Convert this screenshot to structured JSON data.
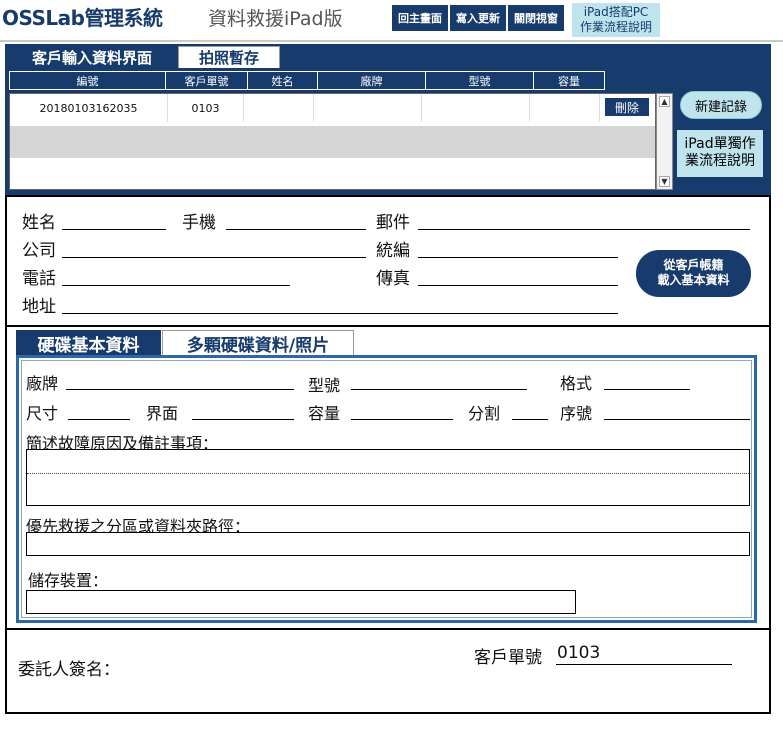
{
  "header": {
    "brand": "OSSLab管理系統",
    "subtitle": "資料救援iPad版",
    "buttons": [
      "回主畫面",
      "寫入更新",
      "關閉視窗"
    ],
    "help_pc_line1": "iPad搭配PC",
    "help_pc_line2": "作業流程說明"
  },
  "records": {
    "tabs": [
      "客戶輸入資料界面",
      "拍照暫存"
    ],
    "columns": [
      "編號",
      "客戶單號",
      "姓名",
      "廠牌",
      "型號",
      "容量"
    ],
    "rows": [
      {
        "id": "20180103162035",
        "order_no": "0103",
        "name": "",
        "brand": "",
        "model": "",
        "capacity": ""
      }
    ],
    "delete_label": "刪除",
    "new_record_label": "新建記錄",
    "help_ipad_line1": "iPad單獨作",
    "help_ipad_line2": "業流程說明"
  },
  "customer": {
    "labels": {
      "name": "姓名",
      "mobile": "手機",
      "email": "郵件",
      "company": "公司",
      "tax_id": "統編",
      "phone": "電話",
      "fax": "傳真",
      "address": "地址"
    },
    "load_btn_line1": "從客戶帳籍",
    "load_btn_line2": "載入基本資料"
  },
  "disk": {
    "tabs": [
      "硬碟基本資料",
      "多顆硬碟資料/照片"
    ],
    "labels": {
      "brand": "廠牌",
      "model": "型號",
      "format": "格式",
      "size": "尺寸",
      "interface": "界面",
      "capacity": "容量",
      "partition": "分割",
      "serial": "序號",
      "fault_desc": "簡述故障原因及備註事項：",
      "priority_path": "優先救援之分區或資料夾路徑：",
      "storage": "儲存裝置："
    }
  },
  "signature": {
    "client_sign_label": "委託人簽名：",
    "order_label": "客戶單號",
    "order_value": "0103"
  }
}
